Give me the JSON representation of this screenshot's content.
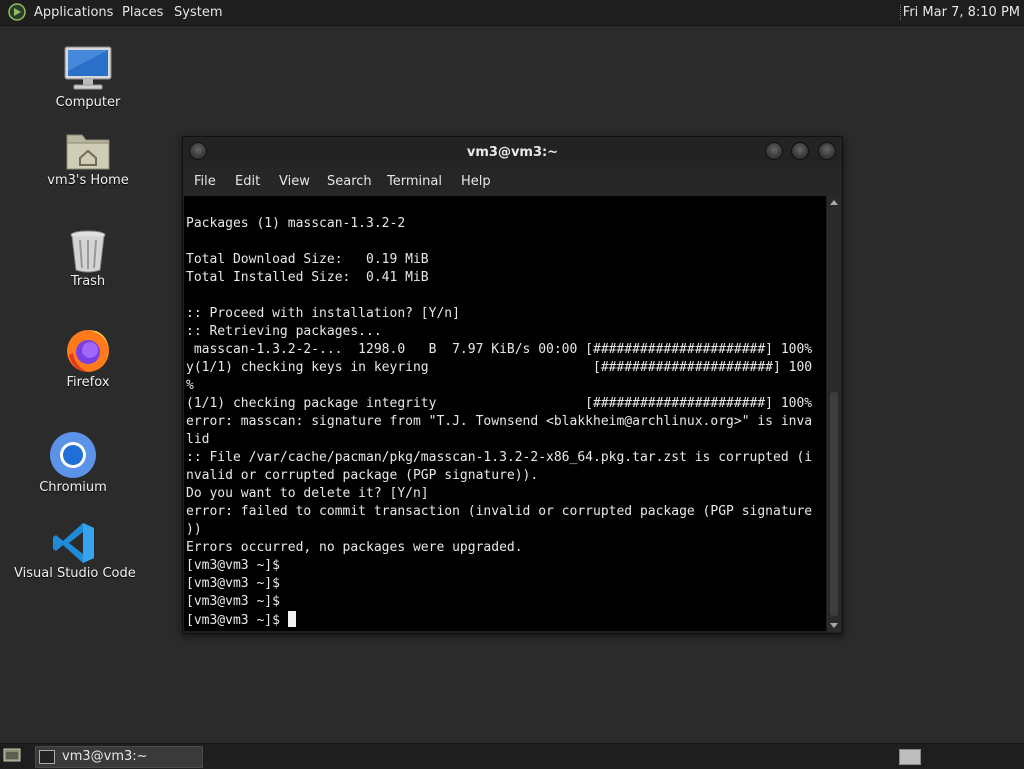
{
  "top_panel": {
    "menu": [
      "Applications",
      "Places",
      "System"
    ],
    "clock": "Fri Mar  7,  8:10 PM"
  },
  "desktop_icons": [
    {
      "label": "Computer",
      "icon": "computer-icon"
    },
    {
      "label": "vm3's Home",
      "icon": "home-folder-icon"
    },
    {
      "label": "Trash",
      "icon": "trash-icon"
    },
    {
      "label": "Firefox",
      "icon": "firefox-icon"
    },
    {
      "label": "Chromium",
      "icon": "chromium-icon"
    },
    {
      "label": "Visual Studio Code",
      "icon": "vscode-icon"
    }
  ],
  "terminal": {
    "title": "vm3@vm3:~",
    "menu": [
      "File",
      "Edit",
      "View",
      "Search",
      "Terminal",
      "Help"
    ],
    "lines": [
      "Packages (1) masscan-1.3.2-2",
      "",
      "Total Download Size:   0.19 MiB",
      "Total Installed Size:  0.41 MiB",
      "",
      ":: Proceed with installation? [Y/n]",
      ":: Retrieving packages...",
      " masscan-1.3.2-2-...  1298.0   B  7.97 KiB/s 00:00 [######################] 100%",
      "y(1/1) checking keys in keyring                     [######################] 100",
      "%",
      "(1/1) checking package integrity                   [######################] 100%",
      "error: masscan: signature from \"T.J. Townsend <blakkheim@archlinux.org>\" is inva",
      "lid",
      ":: File /var/cache/pacman/pkg/masscan-1.3.2-2-x86_64.pkg.tar.zst is corrupted (i",
      "nvalid or corrupted package (PGP signature)).",
      "Do you want to delete it? [Y/n]",
      "error: failed to commit transaction (invalid or corrupted package (PGP signature",
      "))",
      "Errors occurred, no packages were upgraded.",
      "[vm3@vm3 ~]$",
      "[vm3@vm3 ~]$",
      "[vm3@vm3 ~]$",
      "[vm3@vm3 ~]$ "
    ]
  },
  "taskbar": {
    "task_label": "vm3@vm3:~",
    "task_icon": "terminal-icon"
  }
}
